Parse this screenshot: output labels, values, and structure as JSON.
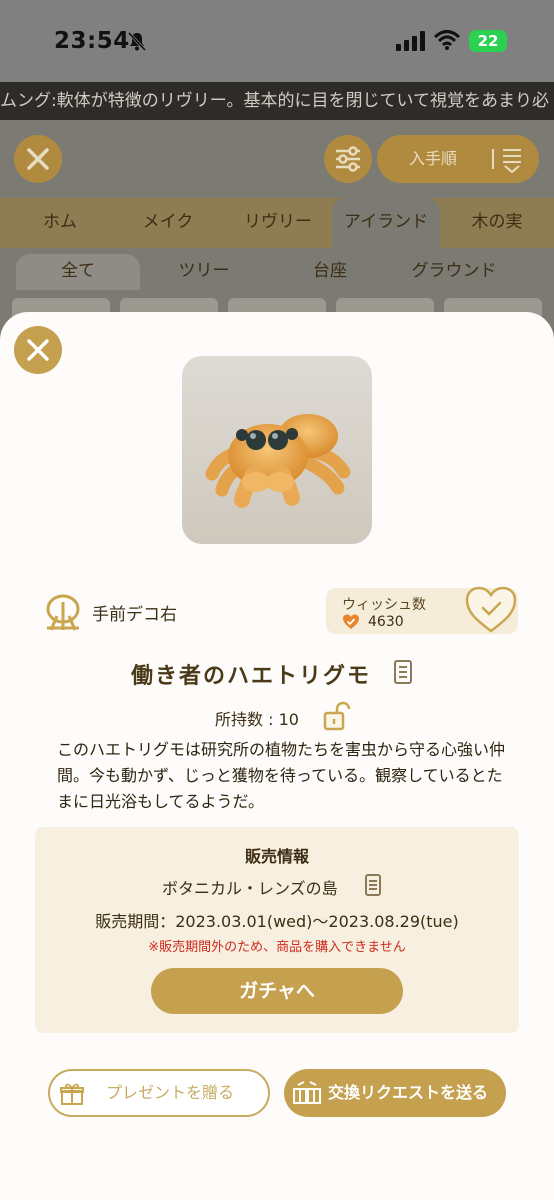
{
  "status_bar": {
    "time": "23:54",
    "battery": "22"
  },
  "ticker": {
    "text": "ムング:軟体が特徴のリヴリー。基本的に目を閉じていて視覚をあまり必"
  },
  "toolbar": {
    "sort_label": "入手順"
  },
  "tabs": [
    {
      "label": "ホム"
    },
    {
      "label": "メイク"
    },
    {
      "label": "リヴリー"
    },
    {
      "label": "アイランド"
    },
    {
      "label": "木の実"
    }
  ],
  "subtabs": [
    {
      "label": "全て"
    },
    {
      "label": "ツリー"
    },
    {
      "label": "台座"
    },
    {
      "label": "グラウンド"
    }
  ],
  "item": {
    "position": "手前デコ右",
    "wish_title": "ウィッシュ数",
    "wish_count": "4630",
    "name": "働き者のハエトリグモ",
    "owned": "所持数 : 10",
    "description": "このハエトリグモは研究所の植物たちを害虫から守る心強い仲間。今も動かず、じっと獲物を待っている。観察しているとたまに日光浴もしてるようだ。"
  },
  "sale": {
    "title": "販売情報",
    "place": "ボタニカル・レンズの島",
    "period": "販売期間：2023.03.01(wed)〜2023.08.29(tue)",
    "warning": "※販売期間外のため、商品を購入できません",
    "gacha_label": "ガチャへ"
  },
  "actions": {
    "present_label": "プレゼントを贈る",
    "trade_label": "交換リクエストを送る"
  },
  "colors": {
    "accent": "#c4a04f",
    "warning": "#d12a1e",
    "sale_bg": "#f7efe0"
  }
}
